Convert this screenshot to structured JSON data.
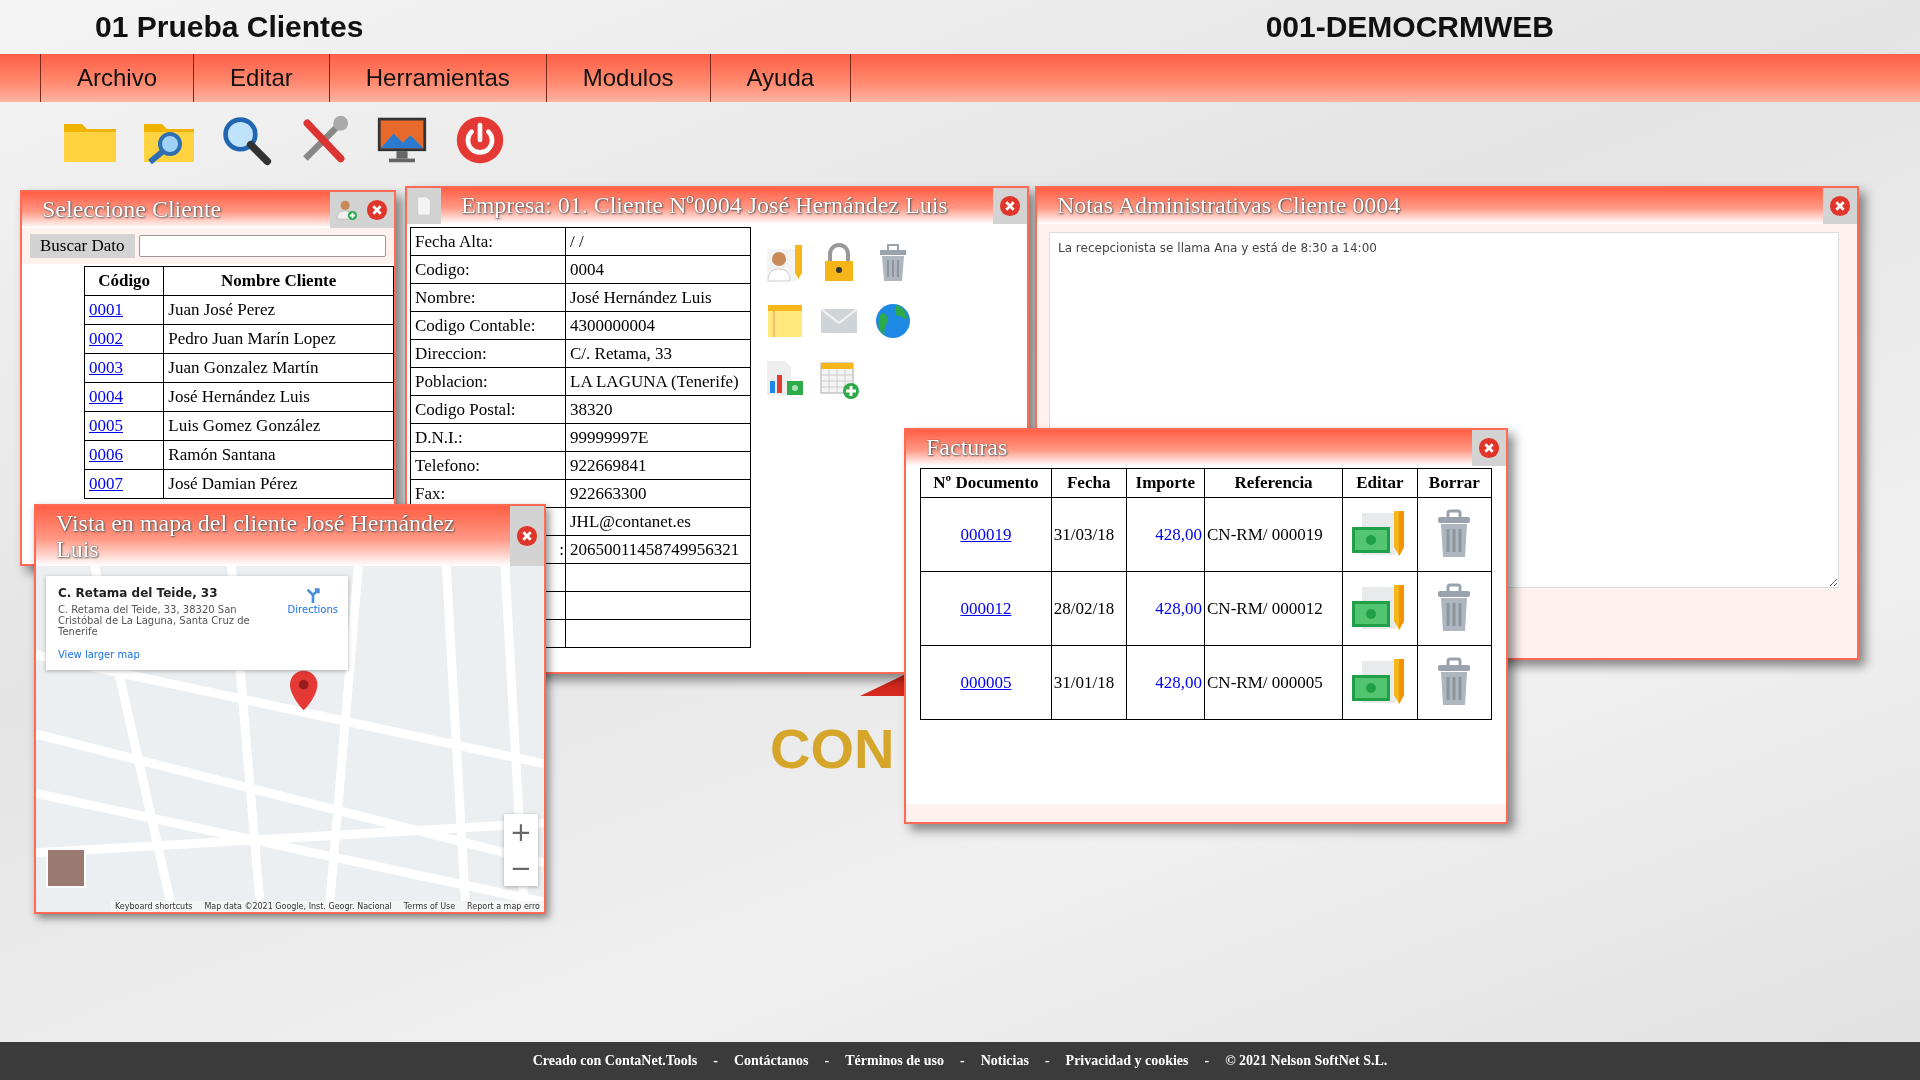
{
  "header": {
    "title": "01 Prueba Clientes",
    "code": "001-DEMOCRMWEB"
  },
  "menu": [
    "Archivo",
    "Editar",
    "Herramientas",
    "Modulos",
    "Ayuda"
  ],
  "client_list": {
    "title": "Seleccione Cliente",
    "search_label": "Buscar Dato",
    "columns": [
      "Código",
      "Nombre Cliente"
    ],
    "rows": [
      {
        "code": "0001",
        "name": "Juan José Perez"
      },
      {
        "code": "0002",
        "name": "Pedro Juan Marín Lopez"
      },
      {
        "code": "0003",
        "name": "Juan Gonzalez Martín"
      },
      {
        "code": "0004",
        "name": "José Hernández Luis"
      },
      {
        "code": "0005",
        "name": "Luis Gomez González"
      },
      {
        "code": "0006",
        "name": "Ramón Santana"
      },
      {
        "code": "0007",
        "name": "José Damian Pérez"
      }
    ]
  },
  "client_card": {
    "title": "Empresa: 01. Cliente Nº0004 José Hernández Luis",
    "fields": [
      {
        "kind": "field",
        "label": "Fecha Alta:",
        "value": "/ /"
      },
      {
        "kind": "field",
        "label": "Codigo:",
        "value": "0004"
      },
      {
        "kind": "field",
        "label": "Nombre:",
        "value": "José Hernández Luis"
      },
      {
        "kind": "field",
        "label": "Codigo Contable:",
        "value": "4300000004"
      },
      {
        "kind": "field",
        "label": "Direccion:",
        "value": "C/. Retama, 33"
      },
      {
        "kind": "field",
        "label": "Poblacion:",
        "value": "LA LAGUNA (Tenerife)"
      },
      {
        "kind": "field",
        "label": "Codigo Postal:",
        "value": "38320"
      },
      {
        "kind": "field",
        "label": "D.N.I.:",
        "value": "99999997E"
      },
      {
        "kind": "field",
        "label": "Telefono:",
        "value": "922669841"
      },
      {
        "kind": "field",
        "label": "Fax:",
        "value": "922663300"
      },
      {
        "kind": "field",
        "value": "JHL@contanet.es"
      },
      {
        "kind": "field",
        "label": ":",
        "value": "20650011458749956321"
      },
      {
        "kind": "blank"
      },
      {
        "kind": "blank"
      },
      {
        "kind": "blank"
      }
    ]
  },
  "notes": {
    "title": "Notas Administrativas Cliente 0004",
    "text": "La recepcionista se llama Ana y está de 8:30 a 14:00"
  },
  "logo_text": "CON",
  "invoices": {
    "title": "Facturas",
    "columns": [
      "Nº Documento",
      "Fecha",
      "Importe",
      "Referencia",
      "Editar",
      "Borrar"
    ],
    "rows": [
      {
        "number": "000019",
        "date": "31/03/18",
        "amount": "428,00",
        "reference": "CN-RM/ 000019"
      },
      {
        "number": "000012",
        "date": "28/02/18",
        "amount": "428,00",
        "reference": "CN-RM/ 000012"
      },
      {
        "number": "000005",
        "date": "31/01/18",
        "amount": "428,00",
        "reference": "CN-RM/ 000005"
      }
    ]
  },
  "map": {
    "title": "Vista en mapa del cliente José Hernández Luis",
    "place_title": "C. Retama del Teide, 33",
    "place_address": "C. Retama del Teide, 33, 38320 San Cristóbal de La Laguna, Santa Cruz de Tenerife",
    "directions": "Directions",
    "larger_map": "View larger map",
    "zoom_in": "+",
    "zoom_out": "−",
    "attribution": [
      "Keyboard shortcuts",
      "Map data ©2021 Google, Inst. Geogr. Nacional",
      "Terms of Use",
      "Report a map erro"
    ]
  },
  "footer": {
    "separator": "-",
    "links": [
      "Creado con ContaNet.Tools",
      "Contáctanos",
      "Términos de uso",
      "Noticias",
      "Privacidad y cookies",
      "© 2021 Nelson SoftNet S.L."
    ]
  }
}
